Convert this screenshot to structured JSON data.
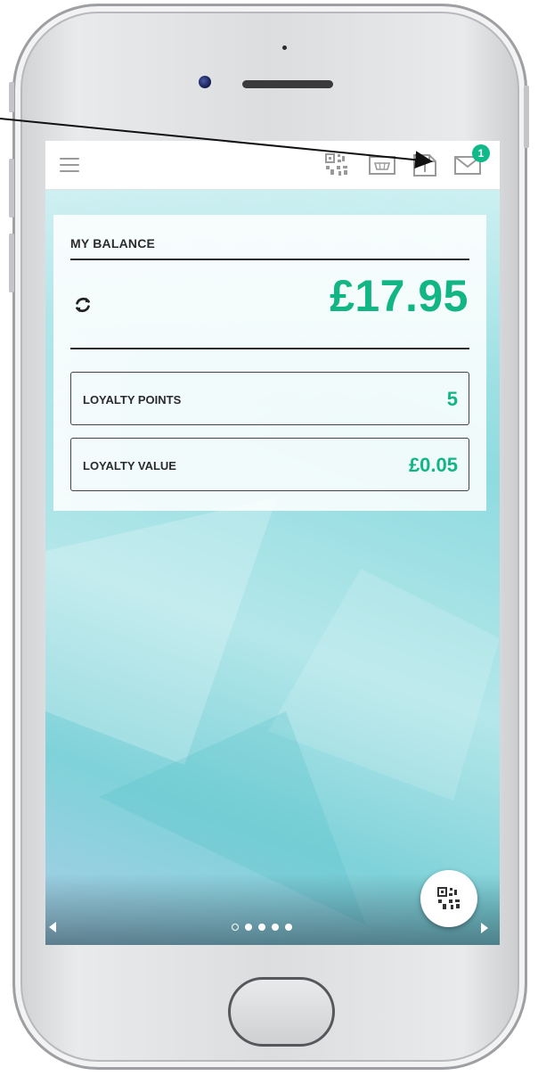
{
  "card": {
    "title": "MY BALANCE",
    "balance": "£17.95",
    "loyalty_points_label": "LOYALTY POINTS",
    "loyalty_points_value": "5",
    "loyalty_value_label": "LOYALTY VALUE",
    "loyalty_value_value": "£0.05"
  },
  "topbar": {
    "icons": [
      "menu-icon",
      "qr-code-icon",
      "basket-icon",
      "document-icon",
      "mail-icon"
    ],
    "mail_badge": "1"
  },
  "pager": {
    "pages": 5,
    "current": 1
  },
  "colors": {
    "accent": "#12b584",
    "badge": "#10b98a",
    "text": "#2b2b2b"
  }
}
